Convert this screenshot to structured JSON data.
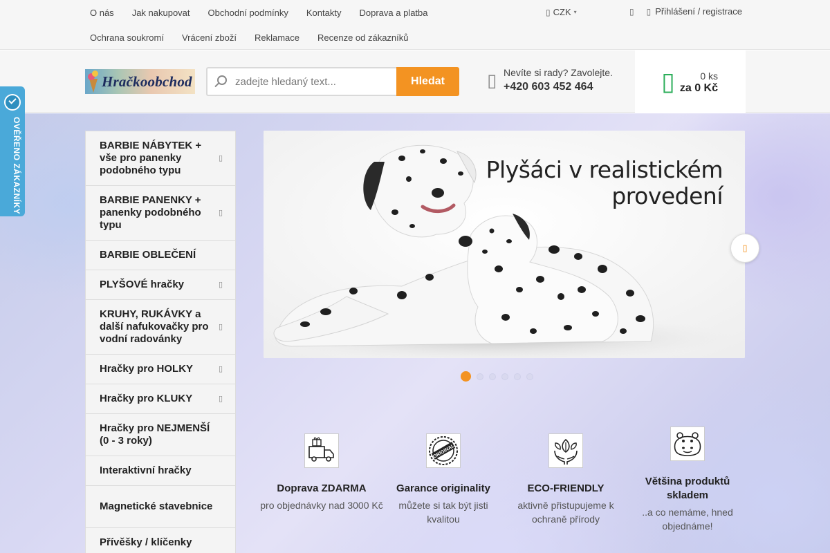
{
  "topnav": {
    "row1": [
      "O nás",
      "Jak nakupovat",
      "Obchodní podmínky",
      "Kontakty",
      "Doprava a platba"
    ],
    "row2": [
      "Ochrana soukromí",
      "Vrácení zboží",
      "Reklamace",
      "Recenze od zákazníků"
    ],
    "currency": "CZK",
    "login": "Přihlášení / registrace"
  },
  "header": {
    "logo_text": "Hračkoobchod",
    "search_placeholder": "zadejte hledaný text...",
    "search_button": "Hledat",
    "phone_question": "Nevíte si rady? Zavolejte.",
    "phone_number": "+420 603 452 464",
    "cart_qty": "0 ks",
    "cart_total": "za 0 Kč"
  },
  "badge": {
    "text": "OVĚŘENO ZÁKAZNÍKY"
  },
  "categories": [
    {
      "label": "BARBIE NÁBYTEK + vše pro panenky podobného typu",
      "has_submenu": true
    },
    {
      "label": "BARBIE PANENKY + panenky podobného typu",
      "has_submenu": true
    },
    {
      "label": "BARBIE OBLEČENÍ",
      "has_submenu": false
    },
    {
      "label": "PLYŠOVÉ hračky",
      "has_submenu": true
    },
    {
      "label": "KRUHY, RUKÁVKY a další nafukovačky pro vodní radovánky",
      "has_submenu": true
    },
    {
      "label": "Hračky pro HOLKY",
      "has_submenu": true
    },
    {
      "label": "Hračky pro KLUKY",
      "has_submenu": true
    },
    {
      "label": "Hračky pro NEJMENŠÍ (0 - 3 roky)",
      "has_submenu": false
    },
    {
      "label": "Interaktivní hračky",
      "has_submenu": false
    },
    {
      "label": "Magnetické stavebnice",
      "has_submenu": false
    },
    {
      "label": "Přívěšky / klíčenky",
      "has_submenu": false
    }
  ],
  "slider": {
    "caption_line1": "Plyšáci v realistickém",
    "caption_line2": "provedení",
    "slide_count": 6,
    "active_index": 0
  },
  "benefits": [
    {
      "icon": "delivery-truck-icon",
      "title": "Doprava ZDARMA",
      "subtitle": "pro objednávky nad 3000 Kč"
    },
    {
      "icon": "original-stamp-icon",
      "title": "Garance originality",
      "subtitle": "můžete si tak být jisti kvalitou"
    },
    {
      "icon": "eco-hands-icon",
      "title": "ECO-FRIENDLY",
      "subtitle": "aktivně přistupujeme k ochraně přírody"
    },
    {
      "icon": "hippo-icon",
      "title": "Většina produktů skladem",
      "subtitle": "..a co nemáme, hned objednáme!"
    }
  ],
  "colors": {
    "accent": "#f39322",
    "cart_green": "#2cae5a",
    "badge_blue": "#4aa9d9"
  }
}
